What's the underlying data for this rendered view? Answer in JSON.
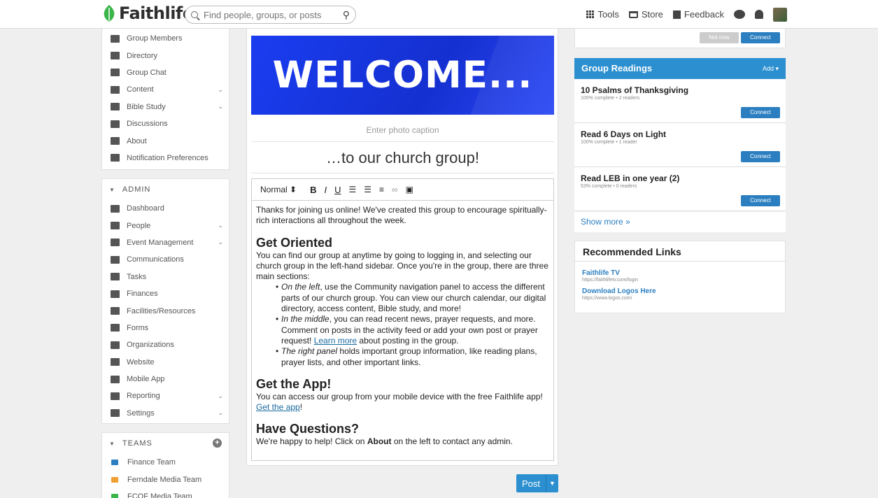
{
  "header": {
    "brand": "Faithlife",
    "search_placeholder": "Find people, groups, or posts",
    "nav": {
      "tools": "Tools",
      "store": "Store",
      "feedback": "Feedback"
    }
  },
  "sidebar": {
    "community": [
      {
        "label": "Group Members",
        "icon": "people-icon"
      },
      {
        "label": "Directory",
        "icon": "directory-icon"
      },
      {
        "label": "Group Chat",
        "icon": "chat-icon"
      },
      {
        "label": "Content",
        "icon": "folder-icon"
      },
      {
        "label": "Bible Study",
        "icon": "bible-icon"
      },
      {
        "label": "Discussions",
        "icon": "discussions-icon"
      },
      {
        "label": "About",
        "icon": "info-icon"
      },
      {
        "label": "Notification Preferences",
        "icon": "bell-icon"
      }
    ],
    "admin_heading": "ADMIN",
    "admin": [
      {
        "label": "Dashboard",
        "icon": "dashboard-icon"
      },
      {
        "label": "People",
        "icon": "people-icon"
      },
      {
        "label": "Event Management",
        "icon": "calendar-icon"
      },
      {
        "label": "Communications",
        "icon": "mail-icon"
      },
      {
        "label": "Tasks",
        "icon": "tasks-icon"
      },
      {
        "label": "Finances",
        "icon": "card-icon"
      },
      {
        "label": "Facilities/Resources",
        "icon": "building-icon"
      },
      {
        "label": "Forms",
        "icon": "form-icon"
      },
      {
        "label": "Organizations",
        "icon": "org-icon"
      },
      {
        "label": "Website",
        "icon": "website-icon"
      },
      {
        "label": "Mobile App",
        "icon": "phone-icon"
      },
      {
        "label": "Reporting",
        "icon": "chart-icon"
      },
      {
        "label": "Settings",
        "icon": "gear-icon"
      }
    ],
    "teams_heading": "TEAMS",
    "teams": [
      {
        "label": "Finance Team",
        "color": "#2b7fc0"
      },
      {
        "label": "Ferndale Media Team",
        "color": "#f0a030"
      },
      {
        "label": "FCOF Media Team",
        "color": "#3ab54a"
      }
    ]
  },
  "post": {
    "banner_text": "WELCOME...",
    "caption_placeholder": "Enter photo caption",
    "title": "…to our church group!",
    "toolbar_format": "Normal",
    "intro": "Thanks for joining us online! We've created this group to encourage spiritually-rich interactions all throughout the week.",
    "h_oriented": "Get Oriented",
    "oriented_p": "You can find our group at anytime by going to logging in, and selecting our church group in the left-hand sidebar. Once you're in the group, there are three main sections:",
    "b1_em": "On the left",
    "b1_rest": ", use the Community navigation panel to access the different parts of our church group. You can view our church calendar, our digital directory, access content, Bible study, and more!",
    "b2_em": "In the middle",
    "b2_rest": ", you can read recent news, prayer requests, and more. Comment on posts in the activity feed or add your own post or prayer request! ",
    "b2_link": "Learn more",
    "b2_tail": " about posting in the group.",
    "b3_em": "The right panel",
    "b3_rest": " holds important group information, like reading plans, prayer lists, and other important links.",
    "h_app": "Get the App!",
    "app_p": "You can access our group from your mobile device with the free Faithlife app! ",
    "app_link": "Get the app",
    "app_tail": "!",
    "h_questions": "Have Questions?",
    "q_pre": "We're happy to help! Click on ",
    "q_bold": "About",
    "q_post": " on the left to contact any admin.",
    "post_label": "Post"
  },
  "right": {
    "notnow": "Not now",
    "connect": "Connect",
    "readings_title": "Group Readings",
    "readings_add": "Add ▾",
    "readings": [
      {
        "name": "10 Psalms of Thanksgiving",
        "meta": "100% complete • 2 readers"
      },
      {
        "name": "Read 6 Days on Light",
        "meta": "100% complete • 1 reader"
      },
      {
        "name": "Read LEB in one year (2)",
        "meta": "53% complete • 0 readers"
      }
    ],
    "show_more": "Show more »",
    "links_title": "Recommended Links",
    "links": [
      {
        "title": "Faithlife TV",
        "url": "https://faithlifetv.com/login"
      },
      {
        "title": "Download Logos Here",
        "url": "https://www.logos.com/"
      }
    ]
  },
  "colors": {
    "accent": "#2b8fd0",
    "banner": "#1a3df0",
    "brand_green": "#3ab54a"
  }
}
